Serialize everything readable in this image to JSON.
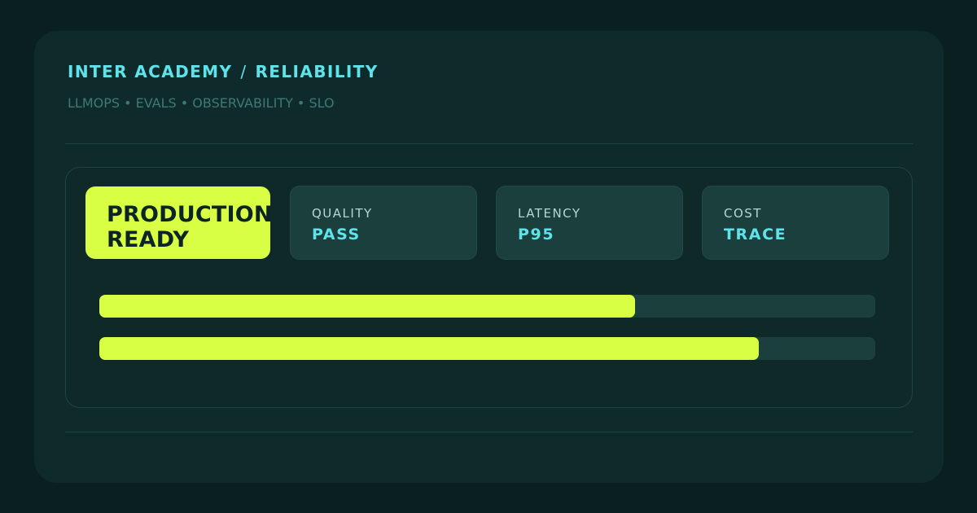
{
  "header": {
    "title_left": "INTER ACADEMY",
    "title_separator": "/",
    "title_right": "RELIABILITY",
    "subtitle": "LLMOPS • EVALS • OBSERVABILITY • SLO"
  },
  "badge": {
    "label": "PRODUCTION\nREADY"
  },
  "tiles": [
    {
      "label": "QUALITY",
      "value": "PASS"
    },
    {
      "label": "LATENCY",
      "value": "P95"
    },
    {
      "label": "COST",
      "value": "TRACE"
    }
  ],
  "progress_bars": [
    {
      "fraction": 0.69
    },
    {
      "fraction": 0.85
    }
  ],
  "colors": {
    "accent": "#d9ff45",
    "title": "#5fe3ea",
    "background": "#0a1f1f",
    "card": "#0e2a2a"
  }
}
